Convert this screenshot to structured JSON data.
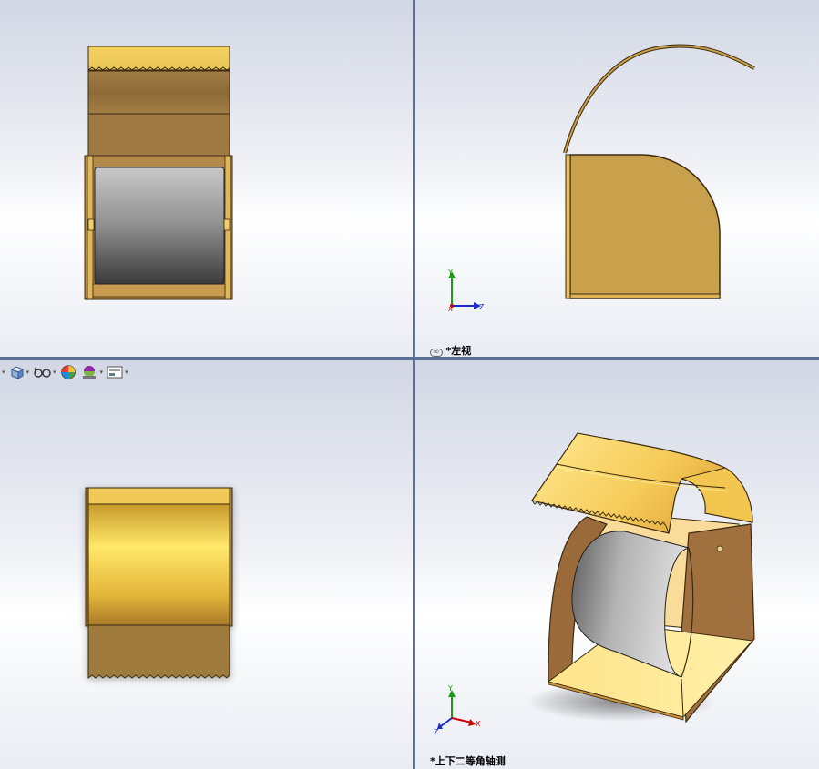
{
  "viewports": {
    "left_view": {
      "label": "*左视"
    },
    "trimetric_view": {
      "label": "*上下二等角轴测"
    }
  },
  "axes": {
    "x": "X",
    "y": "Y",
    "z": "Z"
  },
  "toolbar": {
    "items": [
      {
        "icon": "view-cube-icon"
      },
      {
        "icon": "glasses-icon"
      },
      {
        "icon": "appearance-sphere-icon"
      },
      {
        "icon": "scene-sphere-icon"
      },
      {
        "icon": "display-settings-icon"
      }
    ]
  },
  "colors": {
    "separator": "#5b6f98",
    "gold": "#c9a04c",
    "dark_gold": "#9a7540",
    "bright_gold": "#ffe46a",
    "axis_x": "#cc0000",
    "axis_y": "#00a000",
    "axis_z": "#1a2ccc"
  }
}
